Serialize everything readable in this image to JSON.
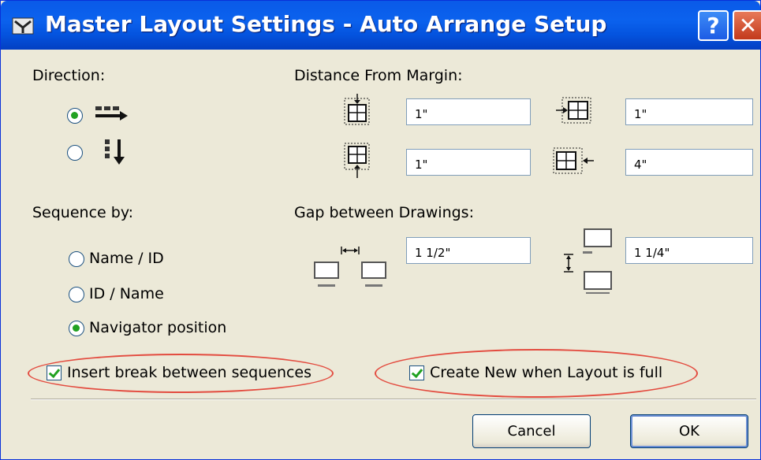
{
  "window": {
    "title": "Master Layout Settings - Auto Arrange Setup",
    "help_label": "?",
    "close_label": "✕"
  },
  "direction": {
    "label": "Direction:",
    "options": [
      {
        "name": "horizontal",
        "checked": true
      },
      {
        "name": "vertical",
        "checked": false
      }
    ]
  },
  "distance": {
    "label": "Distance From Margin:",
    "top": "1\"",
    "left": "1\"",
    "bottom": "1\"",
    "right": "4\""
  },
  "sequence": {
    "label": "Sequence by:",
    "options": [
      {
        "label": "Name / ID",
        "checked": false
      },
      {
        "label": "ID / Name",
        "checked": false
      },
      {
        "label": "Navigator position",
        "checked": true
      }
    ]
  },
  "gap": {
    "label": "Gap between Drawings:",
    "horizontal": "1 1/2\"",
    "vertical": "1 1/4\""
  },
  "checkboxes": {
    "insert_break": {
      "label": "Insert break between sequences",
      "checked": true
    },
    "create_new": {
      "label": "Create New when Layout is full",
      "checked": true
    }
  },
  "buttons": {
    "cancel": "Cancel",
    "ok": "OK"
  },
  "colors": {
    "titlebar": "#0a5ae8",
    "dialog_bg": "#ece9d8",
    "highlight": "#e34b3f",
    "check_green": "#21a121"
  }
}
